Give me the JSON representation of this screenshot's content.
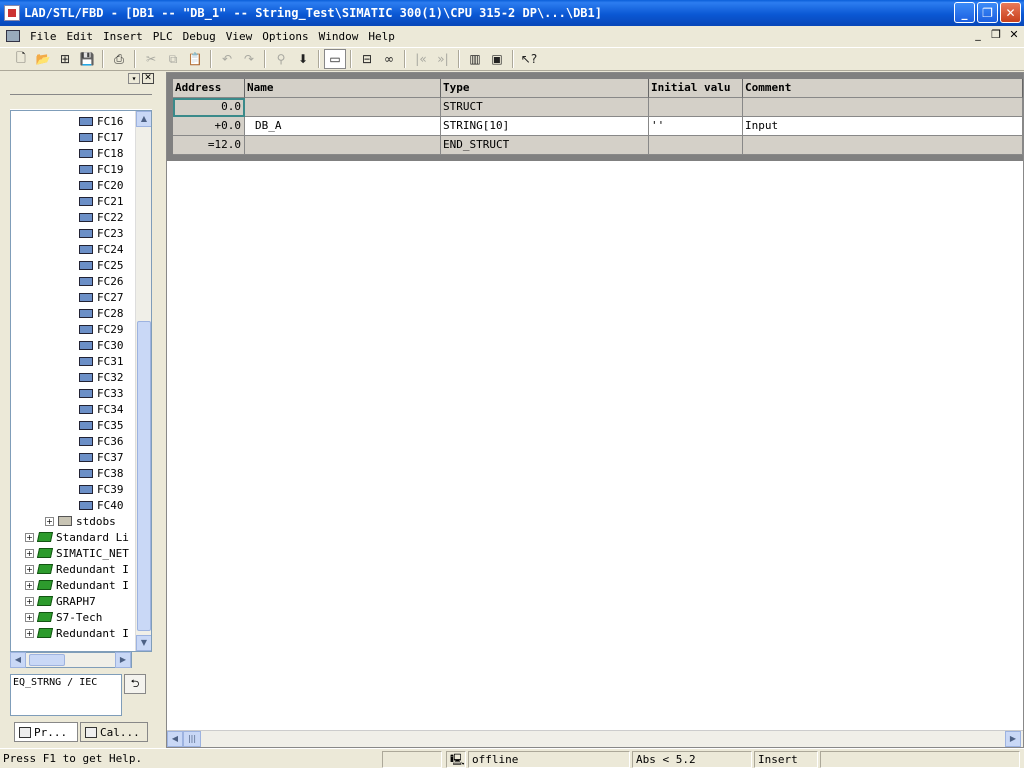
{
  "window": {
    "title": "LAD/STL/FBD  - [DB1 -- \"DB_1\" -- String_Test\\SIMATIC 300(1)\\CPU 315-2 DP\\...\\DB1]",
    "controls": {
      "minimize": "_",
      "restore": "❐",
      "close": "✕"
    }
  },
  "menu": {
    "items": [
      "File",
      "Edit",
      "Insert",
      "PLC",
      "Debug",
      "View",
      "Options",
      "Window",
      "Help"
    ],
    "mdi": {
      "minimize": "_",
      "restore": "❐",
      "close": "✕"
    }
  },
  "tree": {
    "fc_items": [
      "FC16",
      "FC17",
      "FC18",
      "FC19",
      "FC20",
      "FC21",
      "FC22",
      "FC23",
      "FC24",
      "FC25",
      "FC26",
      "FC27",
      "FC28",
      "FC29",
      "FC30",
      "FC31",
      "FC32",
      "FC33",
      "FC34",
      "FC35",
      "FC36",
      "FC37",
      "FC38",
      "FC39",
      "FC40"
    ],
    "folder": "stdobs",
    "libraries": [
      "Standard Li",
      "SIMATIC_NET",
      "Redundant I",
      "Redundant I",
      "GRAPH7",
      "S7-Tech",
      "Redundant I"
    ]
  },
  "info_box": {
    "text": "EQ_STRNG / IEC",
    "button": "⮌"
  },
  "left_tabs": [
    "Pr...",
    "Cal..."
  ],
  "table": {
    "headers": [
      "Address",
      "Name",
      "Type",
      "Initial valu",
      "Comment"
    ],
    "rows": [
      {
        "address": "0.0",
        "name": "",
        "type": "STRUCT",
        "initial": "",
        "comment": ""
      },
      {
        "address": "+0.0",
        "name": "DB_A",
        "type": "STRING[10]",
        "initial": "''",
        "comment": "Input"
      },
      {
        "address": "=12.0",
        "name": "",
        "type": "END_STRUCT",
        "initial": "",
        "comment": ""
      }
    ]
  },
  "status": {
    "help": "Press F1 to get Help.",
    "connection": "offline",
    "position": "Abs < 5.2",
    "mode": "Insert"
  }
}
